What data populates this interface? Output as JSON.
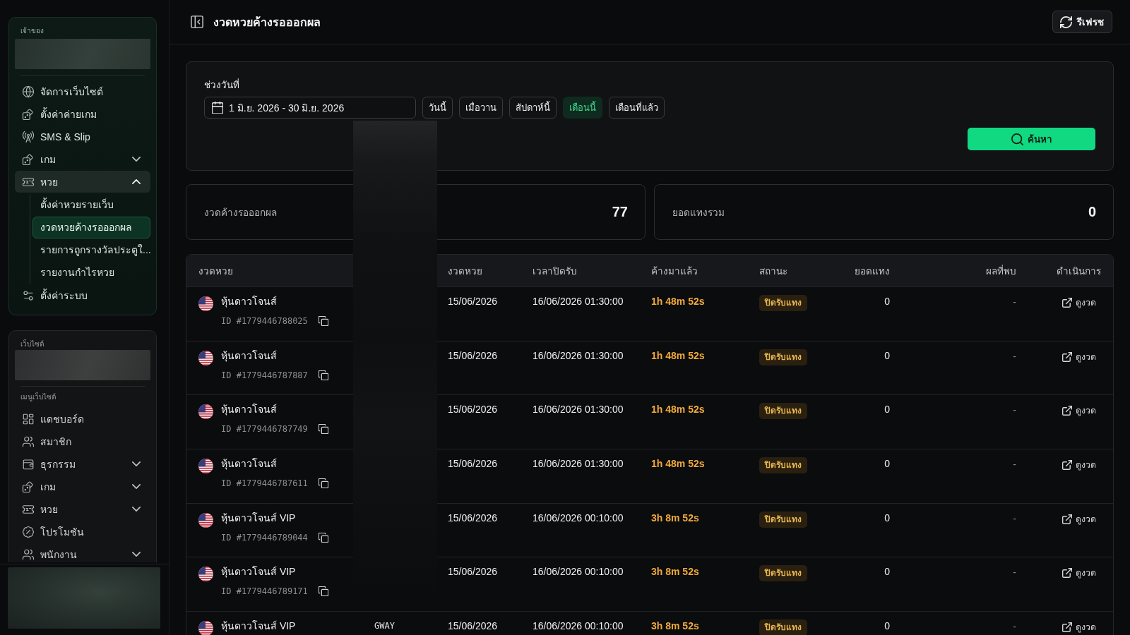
{
  "sidebar": {
    "owner_section": {
      "label": "เจ้าของ",
      "items": [
        {
          "label": "จัดการเว็บไซต์",
          "selected": false
        },
        {
          "label": "ตั้งค่าค่ายเกม",
          "selected": false
        },
        {
          "label": "SMS & Slip",
          "selected": false
        },
        {
          "label": "เกม",
          "selected": false,
          "expanded": false
        },
        {
          "label": "หวย",
          "selected": false,
          "expanded": true,
          "children": [
            {
              "label": "ตั้งค่าหวยรายเว็บ",
              "selected": false
            },
            {
              "label": "งวดหวยค้างรอออกผล",
              "selected": true
            },
            {
              "label": "รายการถูกรางวัลประตูใ...",
              "selected": false
            },
            {
              "label": "รายงานกำไรหวย",
              "selected": false
            }
          ]
        },
        {
          "label": "ตั้งค่าระบบ",
          "selected": false
        }
      ]
    },
    "website_section": {
      "label": "เว็บไซต์",
      "menu_label": "เมนูเว็บไซต์",
      "items": [
        {
          "label": "แดชบอร์ด",
          "selected": false
        },
        {
          "label": "สมาชิก",
          "selected": false
        },
        {
          "label": "ธุรกรรม",
          "selected": false,
          "expanded": false
        },
        {
          "label": "เกม",
          "selected": false,
          "expanded": false
        },
        {
          "label": "หวย",
          "selected": false,
          "expanded": false
        },
        {
          "label": "โปรโมชัน",
          "selected": false
        },
        {
          "label": "พนักงาน",
          "selected": false,
          "expanded": false
        }
      ]
    }
  },
  "header": {
    "title": "งวดหวยค้างรอออกผล",
    "refresh_button": "รีเฟรช"
  },
  "filter": {
    "label": "ช่วงวันที่",
    "date_range": "1 มิ.ย. 2026 - 30 มิ.ย. 2026",
    "presets": [
      {
        "label": "วันนี้",
        "selected": false
      },
      {
        "label": "เมื่อวาน",
        "selected": false
      },
      {
        "label": "สัปดาห์นี้",
        "selected": false
      },
      {
        "label": "เดือนนี้",
        "selected": true
      },
      {
        "label": "เดือนที่แล้ว",
        "selected": false
      }
    ],
    "search_button": "ค้นหา"
  },
  "stats": [
    {
      "label": "งวดค้างรอออกผล",
      "value": "77"
    },
    {
      "label": "ยอดแทงรวม",
      "value": "0"
    }
  ],
  "table": {
    "columns": [
      "งวดหวย",
      "งวดหวย",
      "เวลาปิดรับ",
      "ค้างมาแล้ว",
      "สถานะ",
      "ยอดแทง",
      "ผลที่พบ",
      "ดำเนินการ"
    ],
    "rows": [
      {
        "name": "หุ้นดาวโจนส์",
        "id": "ID #1779446788025",
        "draw_date": "15/06/2026",
        "close_time": "16/06/2026 01:30:00",
        "pending": "1h 48m 52s",
        "status": "ปิดรับแทง",
        "bet_total": "0",
        "result": "-",
        "action": "ดูงวด"
      },
      {
        "name": "หุ้นดาวโจนส์",
        "id": "ID #1779446787887",
        "draw_date": "15/06/2026",
        "close_time": "16/06/2026 01:30:00",
        "pending": "1h 48m 52s",
        "status": "ปิดรับแทง",
        "bet_total": "0",
        "result": "-",
        "action": "ดูงวด"
      },
      {
        "name": "หุ้นดาวโจนส์",
        "id": "ID #1779446787749",
        "draw_date": "15/06/2026",
        "close_time": "16/06/2026 01:30:00",
        "pending": "1h 48m 52s",
        "status": "ปิดรับแทง",
        "bet_total": "0",
        "result": "-",
        "action": "ดูงวด"
      },
      {
        "name": "หุ้นดาวโจนส์",
        "id": "ID #1779446787611",
        "draw_date": "15/06/2026",
        "close_time": "16/06/2026 01:30:00",
        "pending": "1h 48m 52s",
        "status": "ปิดรับแทง",
        "bet_total": "0",
        "result": "-",
        "action": "ดูงวด"
      },
      {
        "name": "หุ้นดาวโจนส์ VIP",
        "id": "ID #1779446789044",
        "draw_date": "15/06/2026",
        "close_time": "16/06/2026 00:10:00",
        "pending": "3h 8m 52s",
        "status": "ปิดรับแทง",
        "bet_total": "0",
        "result": "-",
        "action": "ดูงวด"
      },
      {
        "name": "หุ้นดาวโจนส์ VIP",
        "id": "ID #1779446789171",
        "draw_date": "15/06/2026",
        "close_time": "16/06/2026 00:10:00",
        "pending": "3h 8m 52s",
        "status": "ปิดรับแทง",
        "bet_total": "0",
        "result": "-",
        "action": "ดูงวด"
      },
      {
        "name": "หุ้นดาวโจนส์ VIP",
        "column_2": "GWAY",
        "draw_date": "15/06/2026",
        "close_time": "16/06/2026 00:10:00",
        "pending": "3h 8m 52s",
        "status": "ปิดรับแทง",
        "bet_total": "0",
        "result": "-",
        "action": "ดูงวด"
      }
    ]
  }
}
